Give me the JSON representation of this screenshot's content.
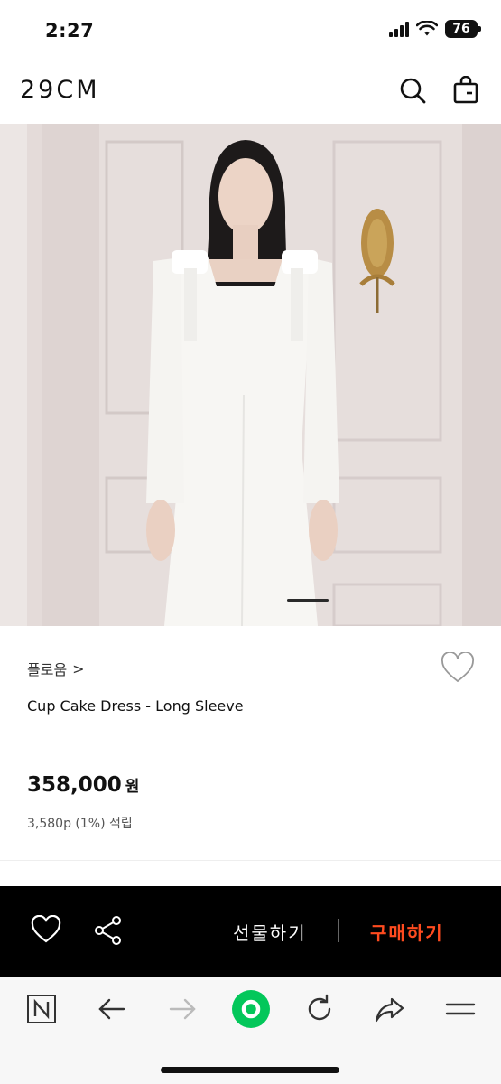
{
  "status_bar": {
    "time": "2:27",
    "battery": "76"
  },
  "header": {
    "logo": "29CM",
    "search_icon": "search-icon",
    "cart_icon": "shopping-bag-icon"
  },
  "product": {
    "brand": "플로움",
    "brand_chevron": ">",
    "name": "Cup Cake Dress - Long Sleeve",
    "price": "358,000",
    "currency": "원",
    "points": "3,580p (1%) 적립"
  },
  "buy_bar": {
    "like_icon": "heart-icon",
    "share_icon": "share-icon",
    "gift_label": "선물하기",
    "buy_label": "구매하기",
    "buy_color": "#ff4b1f"
  },
  "browser_toolbar": {
    "items": [
      "naver-n-icon",
      "back-arrow-icon",
      "forward-arrow-icon",
      "green-home-icon",
      "refresh-icon",
      "share-arrow-icon",
      "menu-icon"
    ],
    "accent": "#03c75a"
  }
}
